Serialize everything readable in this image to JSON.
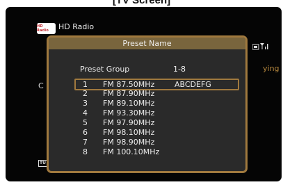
{
  "caption": "[TV Screen]",
  "screen": {
    "title": "HD Radio",
    "logo_text": "HD Radio",
    "background_letter": "C",
    "background_status": "ying",
    "tuner_badge": "TU"
  },
  "dialog": {
    "title": "Preset Name",
    "preset_group_label": "Preset Group",
    "preset_group_value": "1-8",
    "presets": [
      {
        "num": "1",
        "freq": "FM 87.50MHz",
        "name": "ABCDEFG",
        "selected": true
      },
      {
        "num": "2",
        "freq": "FM 87.90MHz",
        "name": ""
      },
      {
        "num": "3",
        "freq": "FM 89.10MHz",
        "name": ""
      },
      {
        "num": "4",
        "freq": "FM 93.30MHz",
        "name": ""
      },
      {
        "num": "5",
        "freq": "FM 97.90MHz",
        "name": ""
      },
      {
        "num": "6",
        "freq": "FM 98.10MHz",
        "name": ""
      },
      {
        "num": "7",
        "freq": "FM 98.90MHz",
        "name": ""
      },
      {
        "num": "8",
        "freq": "FM 100.10MHz",
        "name": ""
      }
    ]
  },
  "colors": {
    "accent_border": "#a0793e",
    "header_bg": "#79653d",
    "status_text": "#b4863d"
  }
}
